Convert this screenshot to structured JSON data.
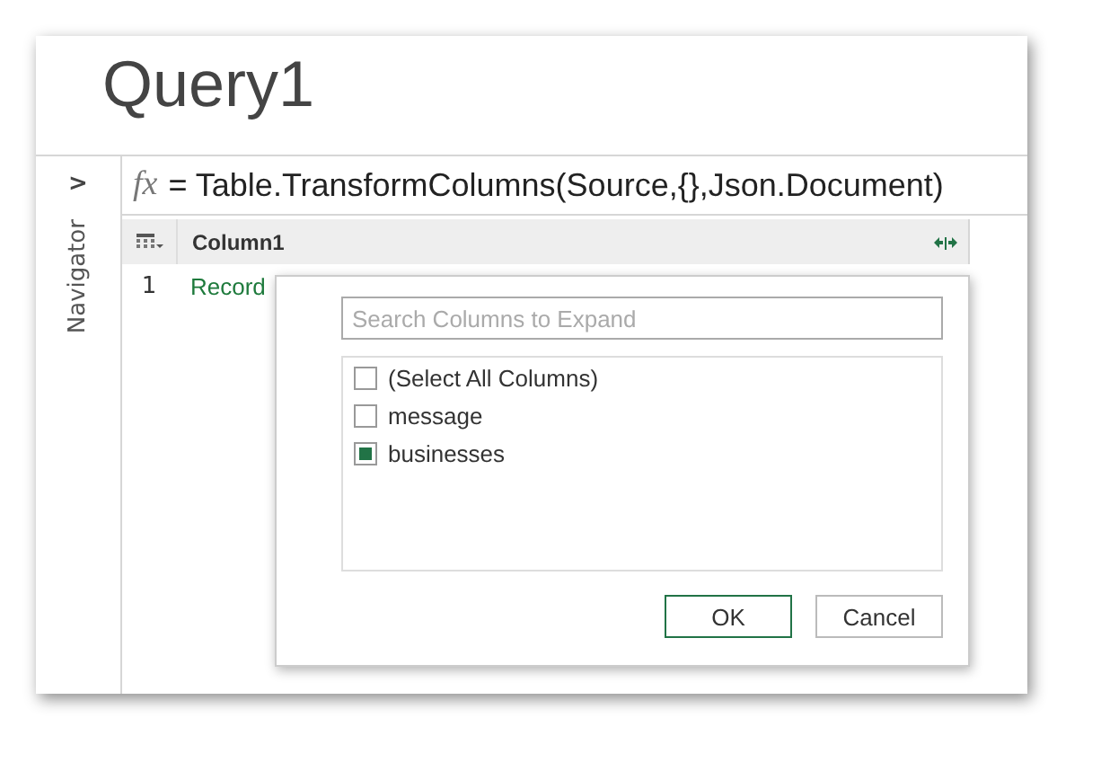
{
  "title": "Query1",
  "navigator": {
    "toggle": ">",
    "label": "Navigator"
  },
  "formula_bar": {
    "fx": "fx",
    "formula": "= Table.TransformColumns(Source,{},Json.Document)"
  },
  "table": {
    "columns": [
      "Column1"
    ],
    "rows": [
      {
        "index": "1",
        "cells": [
          "Record"
        ]
      }
    ]
  },
  "expand_popup": {
    "search": {
      "placeholder": "Search Columns to Expand"
    },
    "columns": [
      {
        "label": "(Select All Columns)",
        "checked": false
      },
      {
        "label": "message",
        "checked": false
      },
      {
        "label": "businesses",
        "checked": true
      }
    ],
    "buttons": [
      {
        "label": "OK",
        "kind": "primary"
      },
      {
        "label": "Cancel",
        "kind": "secondary"
      }
    ]
  }
}
